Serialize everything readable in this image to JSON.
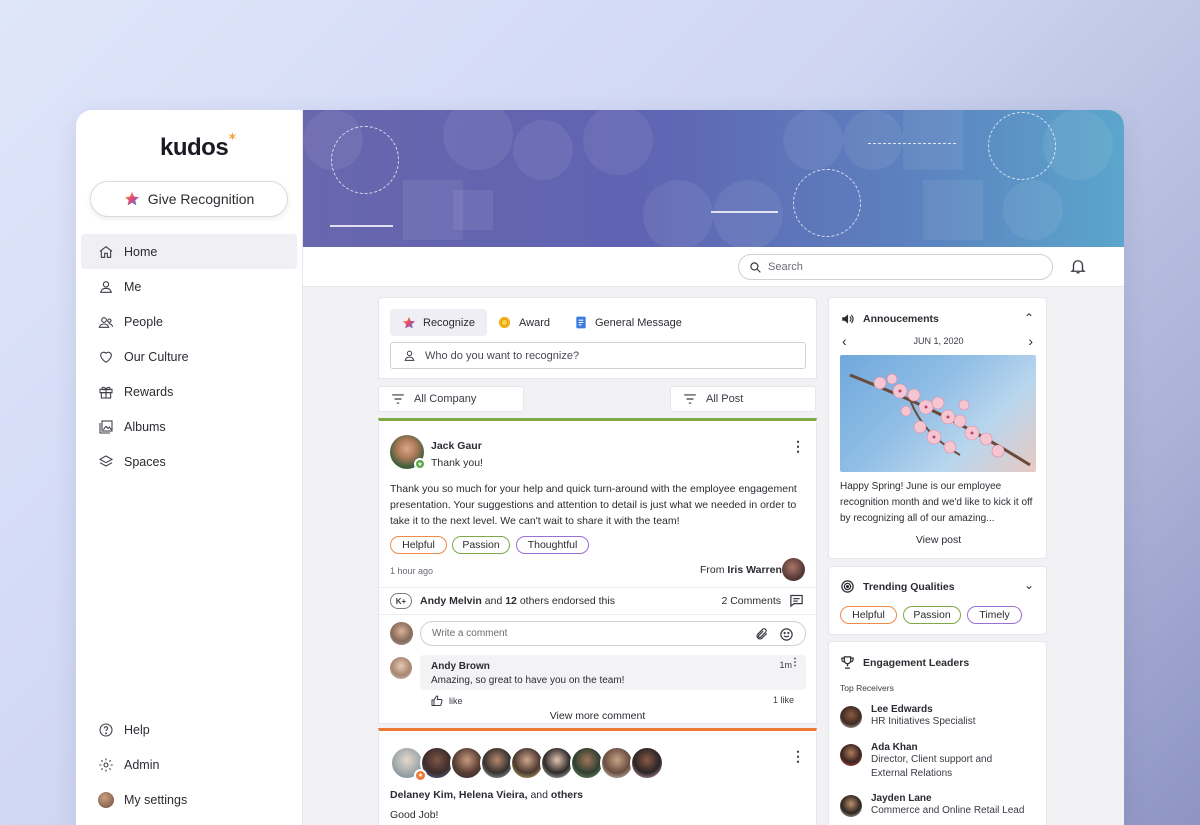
{
  "brand": {
    "name": "kudos",
    "accent": "#f2a33a"
  },
  "sidebar": {
    "give_button": "Give Recognition",
    "items": [
      {
        "label": "Home",
        "icon": "home-icon"
      },
      {
        "label": "Me",
        "icon": "user-icon"
      },
      {
        "label": "People",
        "icon": "people-icon"
      },
      {
        "label": "Our Culture",
        "icon": "heart-icon"
      },
      {
        "label": "Rewards",
        "icon": "gift-icon"
      },
      {
        "label": "Albums",
        "icon": "album-icon"
      },
      {
        "label": "Spaces",
        "icon": "layers-icon"
      }
    ],
    "bottom_items": [
      {
        "label": "Help",
        "icon": "help-icon"
      },
      {
        "label": "Admin",
        "icon": "gear-icon"
      },
      {
        "label": "My settings",
        "icon": "avatar"
      }
    ]
  },
  "topbar": {
    "search_placeholder": "Search"
  },
  "composer": {
    "tabs": [
      {
        "label": "Recognize",
        "icon": "star-icon"
      },
      {
        "label": "Award",
        "icon": "award-icon"
      },
      {
        "label": "General Message",
        "icon": "document-icon"
      }
    ],
    "placeholder": "Who do you want to recognize?"
  },
  "filters": {
    "left": "All Company",
    "right": "All Post"
  },
  "post1": {
    "author": "Jack Gaur",
    "subtitle": "Thank you!",
    "body": "Thank you so much for your help and quick turn-around with the employee engagement presentation. Your suggestions and attention to detail is just what we needed in order to take it to the next level. We can't wait to share it with the team!",
    "tags": [
      {
        "label": "Helpful",
        "color": "#ec8a4a"
      },
      {
        "label": "Passion",
        "color": "#7ea948"
      },
      {
        "label": "Thoughtful",
        "color": "#9b6fd6"
      }
    ],
    "time": "1 hour ago",
    "from_prefix": "From",
    "from_name": "Iris Warren",
    "endorse_badge": "K+",
    "endorse_name": "Andy Melvin",
    "endorse_and": "and",
    "endorse_count": "12",
    "endorse_suffix": "others endorsed this",
    "comments_count": "2 Comments",
    "comment_placeholder": "Write a comment",
    "reply": {
      "author": "Andy Brown",
      "time": "1m",
      "text": "Amazing, so great to have you on the team!",
      "like_label": "like",
      "like_count": "1 like"
    },
    "view_more": "View more comment"
  },
  "post2": {
    "names_bold": "Delaney Kim, Helena Vieira,",
    "names_and": "and",
    "names_others": "others",
    "message": "Good Job!"
  },
  "announcements": {
    "title": "Annoucements",
    "date": "JUN 1, 2020",
    "text": "Happy Spring! June is our employee recognition month and we'd like to kick it off by recognizing all of our amazing...",
    "view_post": "View post"
  },
  "trending": {
    "title": "Trending Qualities",
    "tags": [
      {
        "label": "Helpful",
        "color": "#ec8a4a"
      },
      {
        "label": "Passion",
        "color": "#7ea948"
      },
      {
        "label": "Timely",
        "color": "#9b6fd6"
      }
    ]
  },
  "leaders": {
    "title": "Engagement Leaders",
    "subtitle": "Top Receivers",
    "people": [
      {
        "name": "Lee Edwards",
        "role_line1": "HR Initiatives Specialist",
        "role_line2": ""
      },
      {
        "name": "Ada Khan",
        "role_line1": "Director, Client support and",
        "role_line2": "External Relations"
      },
      {
        "name": "Jayden Lane",
        "role_line1": "Commerce and Online Retail Lead",
        "role_line2": ""
      }
    ]
  }
}
